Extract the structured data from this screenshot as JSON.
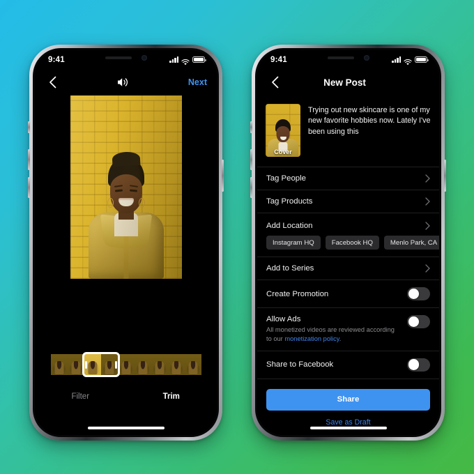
{
  "background": {
    "gradient_from": "#24bce8",
    "gradient_to": "#45b945"
  },
  "accent": {
    "link_blue": "#3f83e8",
    "button_blue": "#3f93f0"
  },
  "left_phone": {
    "status": {
      "time": "9:41",
      "signal_icon": "cellular-signal-icon",
      "wifi_icon": "wifi-icon",
      "battery_icon": "battery-full-icon"
    },
    "nav": {
      "back_icon": "chevron-left-icon",
      "audio_icon": "speaker-volume-icon",
      "next_label": "Next"
    },
    "media": {
      "alt": "Smiling woman in yellow jacket in front of a yellow brick wall"
    },
    "filmstrip": {
      "frame_count": 9,
      "selected_index": 2
    },
    "tabs": [
      {
        "label": "Filter",
        "active": false
      },
      {
        "label": "Trim",
        "active": true
      }
    ]
  },
  "right_phone": {
    "status": {
      "time": "9:41",
      "signal_icon": "cellular-signal-icon",
      "wifi_icon": "wifi-icon",
      "battery_icon": "battery-full-icon"
    },
    "nav": {
      "back_icon": "chevron-left-icon",
      "title": "New Post"
    },
    "composer": {
      "cover_label": "Cover",
      "caption": "Trying out new skincare is one of my new favorite hobbies now. Lately I've been using this"
    },
    "rows": [
      {
        "label": "Tag People",
        "chevron_icon": "chevron-right-icon"
      },
      {
        "label": "Tag Products",
        "chevron_icon": "chevron-right-icon"
      },
      {
        "label": "Add Location",
        "chevron_icon": "chevron-right-icon"
      }
    ],
    "location_chips": [
      "Instagram HQ",
      "Facebook HQ",
      "Menlo Park, CA"
    ],
    "series_row": {
      "label": "Add to Series",
      "chevron_icon": "chevron-right-icon"
    },
    "toggles": [
      {
        "label": "Create Promotion",
        "on": false
      },
      {
        "label": "Allow Ads",
        "on": false,
        "sub_prefix": "All monetized videos are reviewed according to our ",
        "sub_link": "monetization policy",
        "sub_suffix": "."
      },
      {
        "label": "Share to Facebook",
        "on": false
      }
    ],
    "actions": {
      "share_label": "Share",
      "draft_label": "Save as Draft"
    }
  }
}
